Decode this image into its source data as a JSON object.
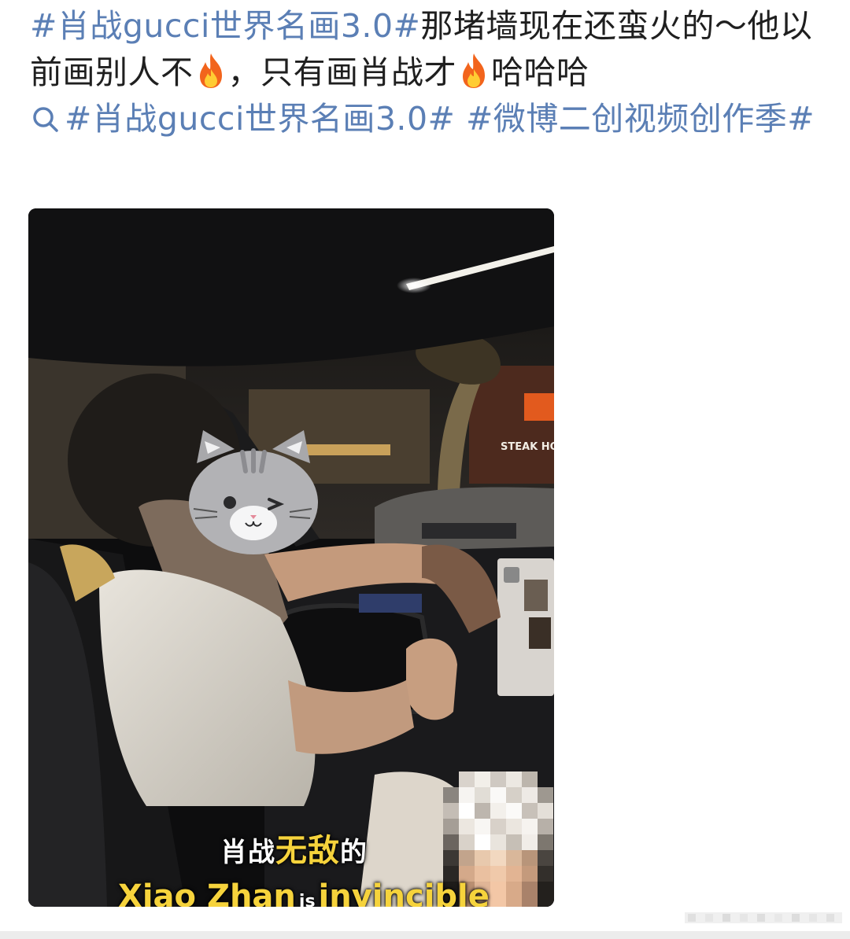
{
  "post": {
    "topic1": "#肖战gucci世界名画3.0#",
    "text1": "那堵墙现在还蛮火的～他以前画别人不",
    "text2": "，只有画肖战才",
    "text3": "哈哈哈",
    "topic2": "#肖战gucci世界名画3.0#",
    "topic3": "#微博二创视频创作季#",
    "fire_icon": "fire-emoji-icon",
    "search_icon": "topic-search-icon"
  },
  "video": {
    "caption_cn_a": "肖战",
    "caption_cn_b": "无敌",
    "caption_cn_c": "的",
    "caption_en_a": "Xiao Zhan",
    "caption_en_b": "is",
    "caption_en_c": "invincible",
    "store_sign": "STEAK HOUS"
  },
  "colors": {
    "topic": "#5b7fb5",
    "text": "#1f1f1f",
    "caption_highlight": "#f6d33c"
  }
}
